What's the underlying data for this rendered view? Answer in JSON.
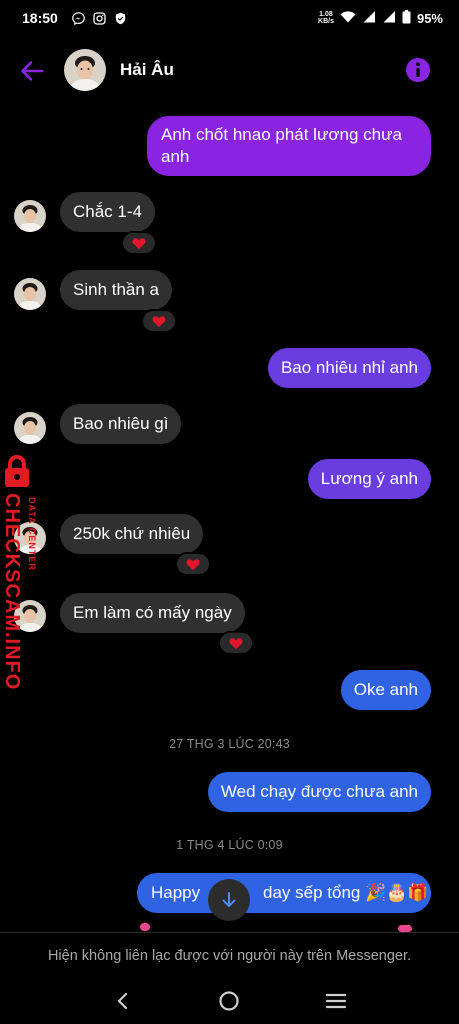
{
  "status": {
    "time": "18:50",
    "net_speed_value": "1.08",
    "net_speed_unit": "KB/s",
    "battery": "95%"
  },
  "header": {
    "contact_name": "Hải Âu"
  },
  "messages": [
    {
      "side": "out",
      "text_line1": "Anh chốt hnao phát lương chưa",
      "text_line2": "anh"
    },
    {
      "side": "in",
      "text": "Chắc 1-4",
      "reaction": "heart"
    },
    {
      "side": "in",
      "text": "Sinh thần a",
      "reaction": "heart"
    },
    {
      "side": "out",
      "text": "Bao nhiêu nhỉ anh"
    },
    {
      "side": "in",
      "text": "Bao nhiêu gì"
    },
    {
      "side": "out",
      "text": "Lương ý anh"
    },
    {
      "side": "in",
      "text": "250k chứ nhiêu",
      "reaction": "heart"
    },
    {
      "side": "in",
      "text": "Em làm có mấy ngày",
      "reaction": "heart"
    },
    {
      "side": "out",
      "text": "Oke anh"
    },
    {
      "side": "out",
      "text": "Wed chạy được chưa anh"
    },
    {
      "side": "out",
      "text_left": "Happy ",
      "text_right": "day sếp tổng 🎉🎂🎁"
    }
  ],
  "timestamps": [
    "27 THG 3 LÚC 20:43",
    "1 THG 4 LÚC 0:09"
  ],
  "watermark": {
    "brand": "CHECKSCAM.INFO",
    "sub": "DATA CENTER"
  },
  "footer": {
    "notice": "Hiện không liên lạc được với người này trên Messenger."
  },
  "colors": {
    "accent_purple": "#8a24e0",
    "bubble_violet": "#6a3de0",
    "bubble_blue": "#2f63e3",
    "incoming_bubble": "#303030",
    "watermark_red": "#e01b24"
  }
}
